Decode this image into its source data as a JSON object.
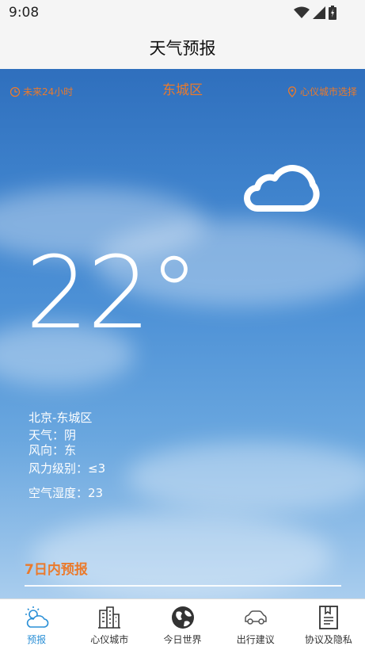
{
  "status_bar": {
    "time": "9:08",
    "icons": [
      "wifi-icon",
      "signal-icon",
      "battery-icon"
    ]
  },
  "header": {
    "title": "天气预报"
  },
  "weather": {
    "left_link": "未来24小时",
    "district": "东城区",
    "right_link": "心仪城市选择",
    "condition_icon": "cloud-icon",
    "temperature": "22°",
    "location": "北京-东城区",
    "weather_line": "天气：阴",
    "wind_direction": "风向：东",
    "wind_level": "风力级别：≤3",
    "humidity": "空气湿度：23",
    "forecast_title": "7日内预报"
  },
  "nav": {
    "items": [
      {
        "label": "预报",
        "icon": "weather-forecast-icon",
        "active": true
      },
      {
        "label": "心仪城市",
        "icon": "city-buildings-icon",
        "active": false
      },
      {
        "label": "今日世界",
        "icon": "globe-icon",
        "active": false
      },
      {
        "label": "出行建议",
        "icon": "car-icon",
        "active": false
      },
      {
        "label": "协议及隐私",
        "icon": "document-icon",
        "active": false
      }
    ]
  },
  "colors": {
    "accent_orange": "#ea7a2c",
    "nav_active": "#2a8fd6",
    "sky_top": "#2f6fbd"
  }
}
